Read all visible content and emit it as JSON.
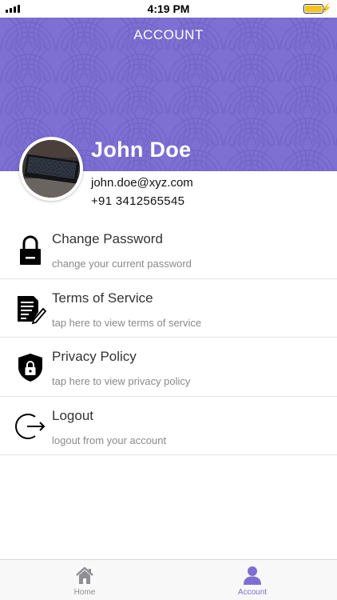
{
  "status_bar": {
    "time": "4:19 PM"
  },
  "header": {
    "title": "ACCOUNT"
  },
  "profile": {
    "name": "John Doe",
    "email": "john.doe@xyz.com",
    "phone": "+91 3412565545"
  },
  "menu": {
    "items": [
      {
        "title": "Change Password",
        "subtitle": "change your current password",
        "icon": "padlock-icon"
      },
      {
        "title": "Terms of Service",
        "subtitle": "tap here to view terms of service",
        "icon": "document-edit-icon"
      },
      {
        "title": "Privacy Policy",
        "subtitle": "tap here to view privacy policy",
        "icon": "shield-lock-icon"
      },
      {
        "title": "Logout",
        "subtitle": "logout from your account",
        "icon": "logout-icon"
      }
    ]
  },
  "tab_bar": {
    "home_label": "Home",
    "account_label": "Account"
  },
  "colors": {
    "accent": "#7e6fd3",
    "header_bg": "#7e6fd3",
    "battery": "#f4c321"
  }
}
